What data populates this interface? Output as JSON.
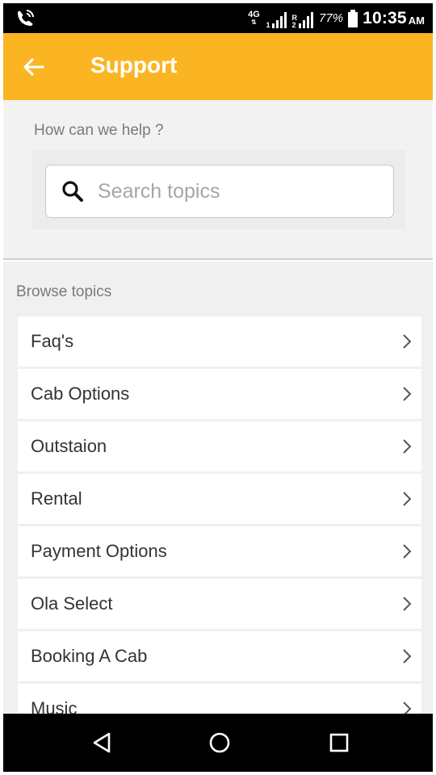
{
  "status_bar": {
    "network_type": "4G",
    "sim1_label": "1",
    "sim2_roaming": "R",
    "sim2_label": "2",
    "battery_percent": "77%",
    "time": "10:35",
    "time_suffix": "AM"
  },
  "app_bar": {
    "title": "Support",
    "color": "#fbb522"
  },
  "help": {
    "heading": "How can we help ?",
    "search_placeholder": "Search topics"
  },
  "browse": {
    "heading": "Browse topics",
    "topics": [
      {
        "label": "Faq's"
      },
      {
        "label": "Cab Options"
      },
      {
        "label": "Outstaion"
      },
      {
        "label": "Rental"
      },
      {
        "label": "Payment Options"
      },
      {
        "label": "Ola Select"
      },
      {
        "label": "Booking A Cab"
      },
      {
        "label": "Music"
      }
    ]
  },
  "icons": {
    "status_left": "phone-call-icon",
    "back": "arrow-left-icon",
    "search": "search-icon",
    "topic_chevron": "chevron-right-icon",
    "nav_back": "triangle-back-icon",
    "nav_home": "circle-home-icon",
    "nav_recents": "square-recents-icon"
  }
}
